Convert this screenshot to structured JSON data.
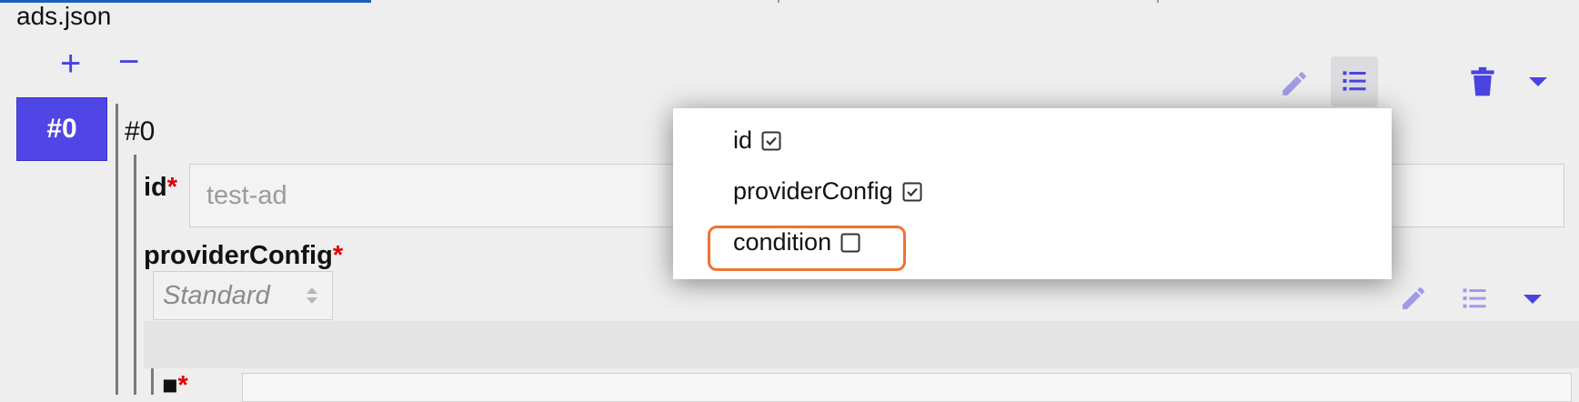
{
  "file_title": "ads.json",
  "item_controls": {
    "add": "+",
    "remove": "−"
  },
  "item_tab_label": "#0",
  "item_heading": "#0",
  "fields": {
    "id": {
      "label": "id",
      "required_mark": "*",
      "placeholder": "test-ad"
    },
    "provider_config": {
      "label": "providerConfig",
      "required_mark": "*",
      "select_value": "Standard"
    },
    "next": {
      "required_mark": "*"
    }
  },
  "popup": {
    "items": [
      {
        "label": "id",
        "checked": true
      },
      {
        "label": "providerConfig",
        "checked": true
      },
      {
        "label": "condition",
        "checked": false
      }
    ]
  },
  "icons": [
    "pencil-icon",
    "list-icon",
    "trash-icon",
    "caret-down-icon",
    "select-arrows-icon",
    "checkbox-icon"
  ],
  "colors": {
    "accent": "#4f46e5",
    "icon_gray": "#a09ae8",
    "required": "#e00000",
    "highlight": "#ef7331"
  }
}
